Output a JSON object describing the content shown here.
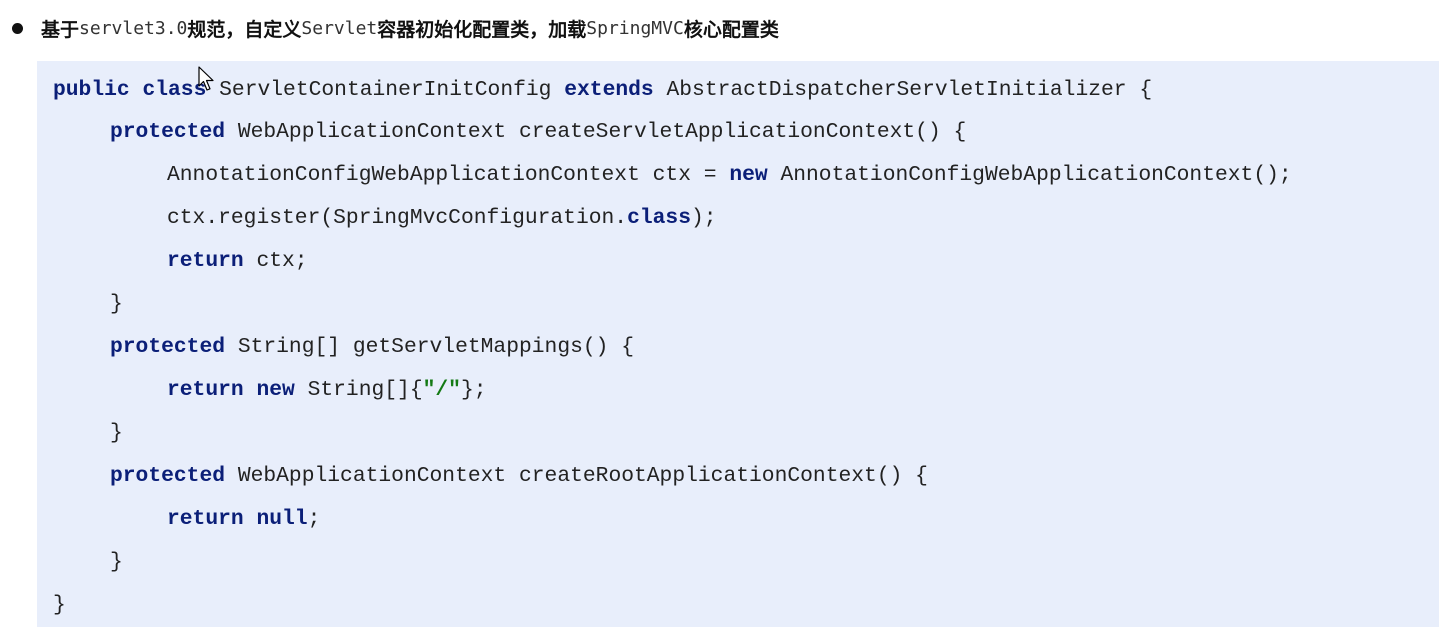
{
  "bullet": {
    "p1": "基于",
    "c1": "servlet3.0",
    "p2": "规范，自定义",
    "c2": "Servlet",
    "p3": "容器初始化配置类，加载",
    "c3": "SpringMVC",
    "p4": "核心配置类"
  },
  "code": {
    "l1": {
      "k1": "public",
      "k2": "class",
      "t1": "ServletContainerInitConfig",
      "k3": "extends",
      "t2": "AbstractDispatcherServletInitializer {"
    },
    "l2": {
      "k1": "protected",
      "t1": "WebApplicationContext createServletApplicationContext() {"
    },
    "l3": {
      "t1": "AnnotationConfigWebApplicationContext ctx =",
      "k1": "new",
      "t2": "AnnotationConfigWebApplicationContext();"
    },
    "l4": {
      "t1": "ctx.register(SpringMvcConfiguration.",
      "k1": "class",
      "t2": ");"
    },
    "l5": {
      "k1": "return",
      "t1": "ctx;"
    },
    "l6": {
      "t1": "}"
    },
    "l7": {
      "k1": "protected",
      "t1": "String[] getServletMappings() {"
    },
    "l8": {
      "k1": "return",
      "k2": "new",
      "t1": "String[]{",
      "s1": "\"/\"",
      "t2": "};"
    },
    "l9": {
      "t1": "}"
    },
    "l10": {
      "k1": "protected",
      "t1": "WebApplicationContext createRootApplicationContext() {"
    },
    "l11": {
      "k1": "return",
      "k2": "null",
      "t1": ";"
    },
    "l12": {
      "t1": "}"
    },
    "l13": {
      "t1": "}"
    }
  },
  "colors": {
    "code_background": "#e8eefb",
    "keyword": "#0b1f78",
    "string": "#147a14"
  },
  "icons": {
    "cursor": "mouse-pointer-icon"
  }
}
